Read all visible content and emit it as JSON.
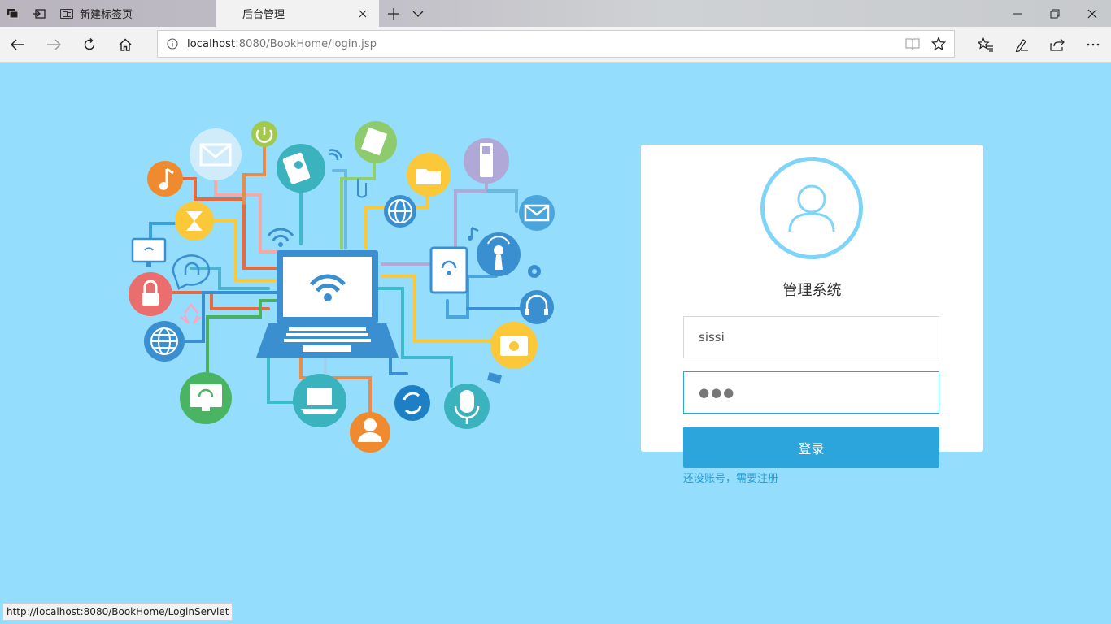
{
  "browser": {
    "tabs": [
      {
        "title": "新建标签页",
        "active": false
      },
      {
        "title": "后台管理",
        "active": true
      }
    ],
    "address": {
      "host": "localhost",
      "rest": ":8080/BookHome/login.jsp"
    },
    "status_url": "http://localhost:8080/BookHome/LoginServlet"
  },
  "login": {
    "title": "管理系统",
    "username_value": "sissi",
    "password_masked": "●●●",
    "submit_label": "登录",
    "register_link": "还没账号，需要注册"
  },
  "colors": {
    "page_bg": "#94ddfc",
    "accent": "#2ba5db",
    "link": "#2a9fd6"
  }
}
